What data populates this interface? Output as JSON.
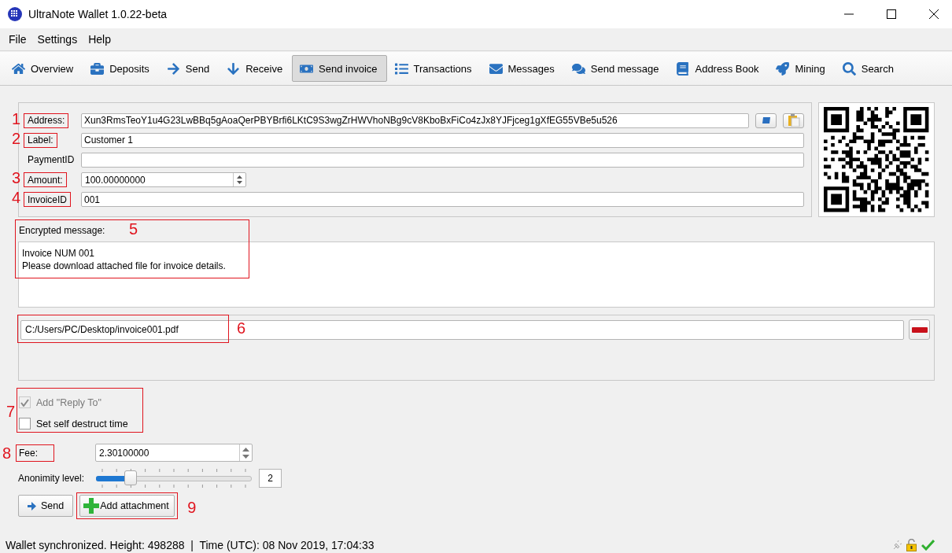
{
  "window": {
    "title": "UltraNote Wallet 1.0.22-beta"
  },
  "menu": [
    {
      "label": "File"
    },
    {
      "label": "Settings"
    },
    {
      "label": "Help"
    }
  ],
  "toolbar": [
    {
      "label": "Overview",
      "selected": false
    },
    {
      "label": "Deposits",
      "selected": false
    },
    {
      "label": "Send",
      "selected": false
    },
    {
      "label": "Receive",
      "selected": false
    },
    {
      "label": "Send invoice",
      "selected": true
    },
    {
      "label": "Transactions",
      "selected": false
    },
    {
      "label": "Messages",
      "selected": false
    },
    {
      "label": "Send message",
      "selected": false
    },
    {
      "label": "Address Book",
      "selected": false
    },
    {
      "label": "Mining",
      "selected": false
    },
    {
      "label": "Search",
      "selected": false
    }
  ],
  "form": {
    "fields": [
      {
        "kind": "address",
        "label": "Address:",
        "value": "Xun3RmsTeoY1u4G23LwBBq5gAoaQerPBYBrfi6LKtC9S3wgZrHWVhoNBg9cV8KboBxFiCo4zJx8YJFjceg1gXfEG55VBe5u526",
        "annotation": "1"
      },
      {
        "kind": "text",
        "label": "Label:",
        "value": "Customer 1",
        "annotation": "2"
      },
      {
        "kind": "text",
        "label": "PaymentID"
      },
      {
        "kind": "spin",
        "label": "Amount:",
        "value": "100.00000000",
        "annotation": "3"
      },
      {
        "kind": "text",
        "label": "InvoiceID",
        "value": "001",
        "annotation": "4"
      }
    ]
  },
  "message": {
    "label": "Encrypted message:",
    "annotation": "5",
    "value": "Invoice NUM 001\nPlease download attached file for invoice details."
  },
  "attachment": {
    "value": "C:/Users/PC/Desktop/invoice001.pdf",
    "annotation": "6"
  },
  "options": {
    "annotation": "7",
    "items": [
      {
        "label": "Add \"Reply To\"",
        "checked": true,
        "disabled": true
      },
      {
        "label": "Set self destruct time",
        "checked": false,
        "disabled": false
      }
    ]
  },
  "fee": {
    "label": "Fee:",
    "value": "2.30100000",
    "annotation": "8"
  },
  "anonymity": {
    "label": "Anonimity level:",
    "level": 0.2,
    "value": "2"
  },
  "buttons": [
    {
      "kind": "send",
      "label": "Send"
    },
    {
      "kind": "attach",
      "label": "Add attachment",
      "annotation": "9"
    }
  ],
  "status_bar": {
    "text": "Wallet synchronized. Height: 498288  |  Time (UTC): 08 Nov 2019, 17:04:33"
  }
}
